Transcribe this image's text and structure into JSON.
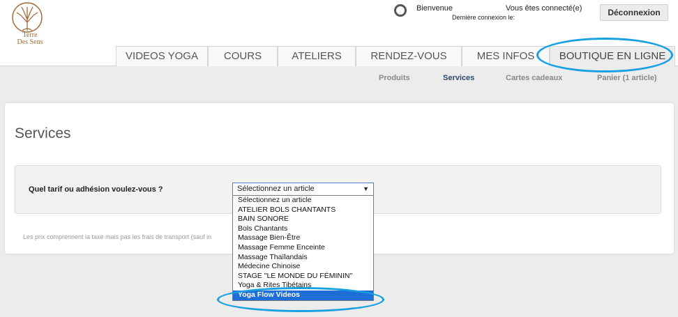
{
  "brand": {
    "line1": "Terre",
    "line2": "Des Sens",
    "color": "#a26a3a"
  },
  "header": {
    "welcome": "Bienvenue",
    "last_login": "Dernière connexion le:",
    "connected": "Vous êtes connecté(e)",
    "logout_label": "Déconnexion"
  },
  "nav": {
    "tabs": [
      {
        "label": "VIDEOS YOGA"
      },
      {
        "label": "COURS"
      },
      {
        "label": "ATELIERS"
      },
      {
        "label": "RENDEZ-VOUS"
      },
      {
        "label": "MES INFOS"
      },
      {
        "label": "BOUTIQUE EN LIGNE",
        "active": true
      }
    ]
  },
  "subnav": {
    "items": [
      {
        "label": "Produits"
      },
      {
        "label": "Services",
        "active": true
      },
      {
        "label": "Cartes cadeaux"
      },
      {
        "label": "Panier (1 article)"
      }
    ]
  },
  "main": {
    "title": "Services",
    "question": "Quel tarif ou adhésion voulez-vous ?",
    "select_value": "Sélectionnez un article",
    "footnote": "Les prix comprennent la taxe mais pas les frais de transport (sauf in"
  },
  "dropdown": {
    "options": [
      "Sélectionnez un article",
      "ATELIER BOLS CHANTANTS",
      "BAIN SONORE",
      "Bols Chantants",
      "Massage Bien-Être",
      "Massage Femme Enceinte",
      "Massage Thaïlandais",
      "Médecine Chinoise",
      "STAGE \"LE MONDE DU FÉMININ\"",
      "Yoga & Rites Tibétains",
      "Yoga Flow Videos"
    ],
    "highlighted_index": 10
  },
  "colors": {
    "accent": "#1e6ed8",
    "annotation": "#18a0e0",
    "link_active": "#2a4a6a"
  }
}
